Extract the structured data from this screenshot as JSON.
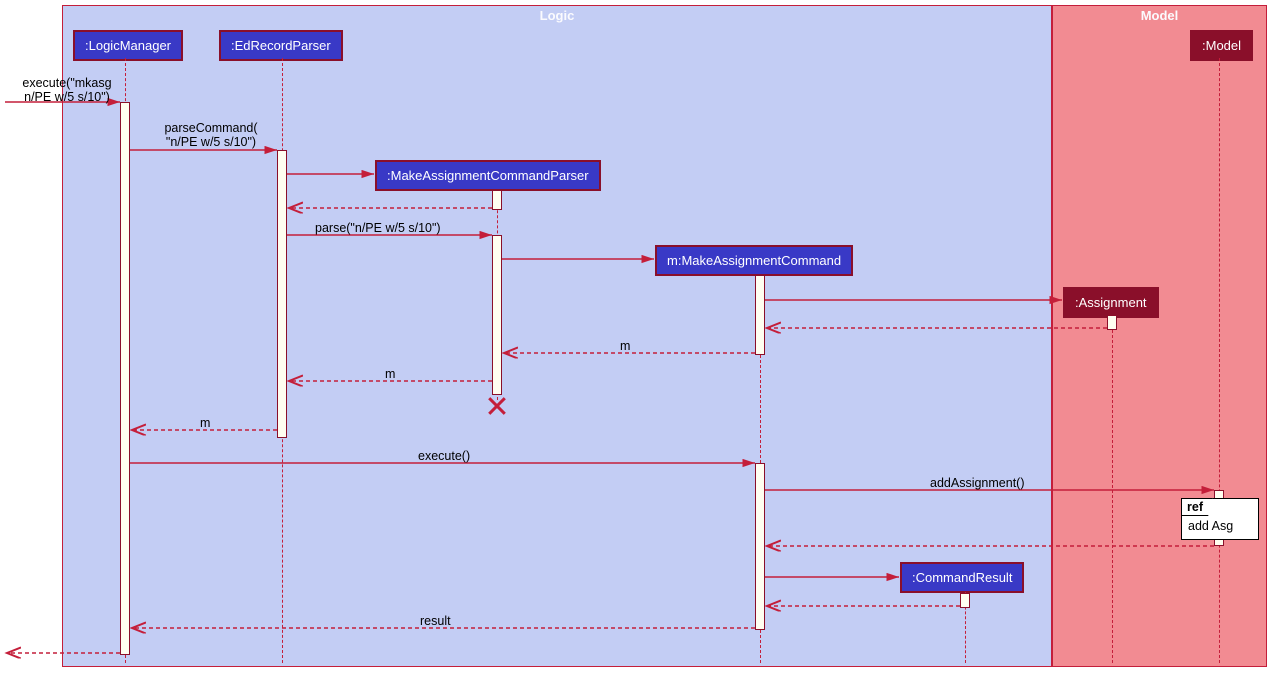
{
  "regions": {
    "logic": "Logic",
    "model": "Model"
  },
  "participants": {
    "logicManager": ":LogicManager",
    "edRecordParser": ":EdRecordParser",
    "makeAsgParser": ":MakeAssignmentCommandParser",
    "makeAsgCmd": "m:MakeAssignmentCommand",
    "commandResult": ":CommandResult",
    "assignment": ":Assignment",
    "modelObj": ":Model"
  },
  "messages": {
    "executeIn": "execute(\"mkasg\nn/PE w/5 s/10\")",
    "parseCommand": "parseCommand(\n\"n/PE w/5 s/10\")",
    "parse": "parse(\"n/PE w/5 s/10\")",
    "m1": "m",
    "m2": "m",
    "m3": "m",
    "executeCall": "execute()",
    "addAssignment": "addAssignment()",
    "result": "result"
  },
  "ref": {
    "label": "ref",
    "body": "add Asg"
  }
}
